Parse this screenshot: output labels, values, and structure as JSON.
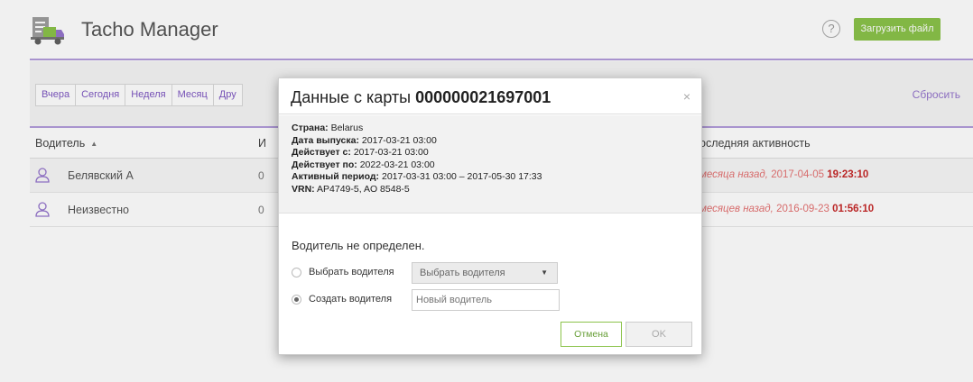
{
  "app": {
    "title": "Tacho Manager",
    "upload_label": "Загрузить файл",
    "help_label": "?"
  },
  "filters": {
    "buttons": [
      "Вчера",
      "Сегодня",
      "Неделя",
      "Месяц",
      "Дру"
    ],
    "reset_label": "Сбросить"
  },
  "table": {
    "headers": {
      "driver": "Водитель",
      "middle": "И",
      "last_activity": "оследняя активность"
    },
    "rows": [
      {
        "name": "Белявский А",
        "mid": "0",
        "relative": "месяца назад,",
        "date": "2017-04-05",
        "time": "19:23:10"
      },
      {
        "name": "Неизвестно",
        "mid": "0",
        "relative": "месяцев назад,",
        "date": "2016-09-23",
        "time": "01:56:10"
      }
    ]
  },
  "modal": {
    "title_prefix": "Данные с карты",
    "card_number": "000000021697001",
    "close": "×",
    "info": [
      {
        "key": "Страна:",
        "value": "Belarus"
      },
      {
        "key": "Дата выпуска:",
        "value": "2017-03-21 03:00"
      },
      {
        "key": "Действует с:",
        "value": "2017-03-21 03:00"
      },
      {
        "key": "Действует по:",
        "value": "2022-03-21 03:00"
      },
      {
        "key": "Активный период:",
        "value": "2017-03-31 03:00 – 2017-05-30 17:33"
      },
      {
        "key": "VRN:",
        "value": "AP4749-5, AO 8548-5"
      }
    ],
    "status_text": "Водитель не определен.",
    "option_select_label": "Выбрать водителя",
    "select_value": "Выбрать водителя",
    "option_create_label": "Создать водителя",
    "create_placeholder": "Новый водитель",
    "selected_option": "create",
    "cancel_label": "Отмена",
    "ok_label": "OK"
  },
  "colors": {
    "accent": "#8bc34a",
    "purple": "#9575cd",
    "danger": "#e57373"
  }
}
